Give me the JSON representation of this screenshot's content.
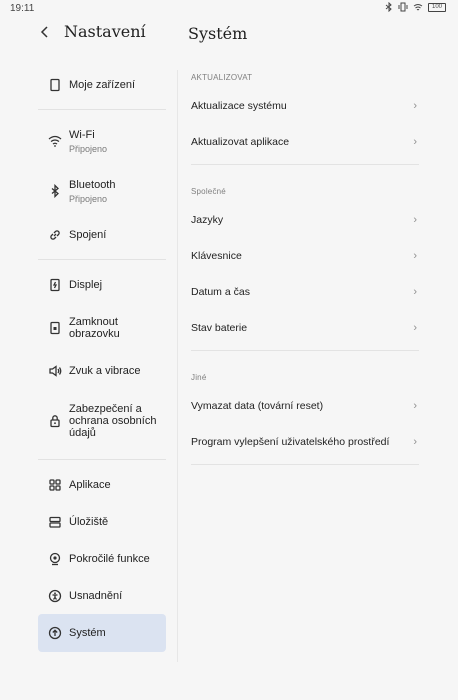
{
  "status": {
    "time": "19:11",
    "battery": "100"
  },
  "header": {
    "back_icon": "chevron-left-icon",
    "left_title": "Nastavení",
    "right_title": "Systém"
  },
  "sidebar": {
    "groups": [
      [
        {
          "id": "moje",
          "label": "Moje zařízení",
          "icon": "phone-outline-icon"
        }
      ],
      [
        {
          "id": "wifi",
          "label": "Wi-Fi",
          "sub": "Připojeno",
          "icon": "wifi-icon"
        },
        {
          "id": "bt",
          "label": "Bluetooth",
          "sub": "Připojeno",
          "icon": "bluetooth-icon"
        },
        {
          "id": "spojeni",
          "label": "Spojení",
          "icon": "link-icon"
        }
      ],
      [
        {
          "id": "displej",
          "label": "Displej",
          "icon": "display-icon"
        },
        {
          "id": "zamknout",
          "label": "Zamknout\nobrazovku",
          "icon": "lock-screen-icon"
        },
        {
          "id": "zvuk",
          "label": "Zvuk a vibrace",
          "icon": "speaker-icon"
        },
        {
          "id": "zabezpeceni",
          "label": "Zabezpečení a\nochrana osobních\núdajů",
          "icon": "padlock-icon"
        }
      ],
      [
        {
          "id": "aplikace",
          "label": "Aplikace",
          "icon": "grid-icon"
        },
        {
          "id": "uloziste",
          "label": "Úložiště",
          "icon": "storage-icon"
        },
        {
          "id": "pokrocile",
          "label": "Pokročilé funkce",
          "icon": "advanced-features-icon"
        },
        {
          "id": "usnadneni",
          "label": "Usnadnění",
          "icon": "accessibility-icon"
        },
        {
          "id": "system",
          "label": "Systém",
          "icon": "system-update-icon",
          "active": true
        }
      ]
    ]
  },
  "content": {
    "sections": [
      {
        "label": "AKTUALIZOVAT",
        "rows": [
          "Aktualizace systému",
          "Aktualizovat aplikace"
        ]
      },
      {
        "label": "Společné",
        "rows": [
          "Jazyky",
          "Klávesnice",
          "Datum a čas",
          "Stav baterie"
        ]
      },
      {
        "label": "Jiné",
        "rows": [
          "Vymazat data (tovární reset)",
          "Program vylepšení uživatelského prostředí"
        ]
      }
    ],
    "chevron": "›"
  }
}
